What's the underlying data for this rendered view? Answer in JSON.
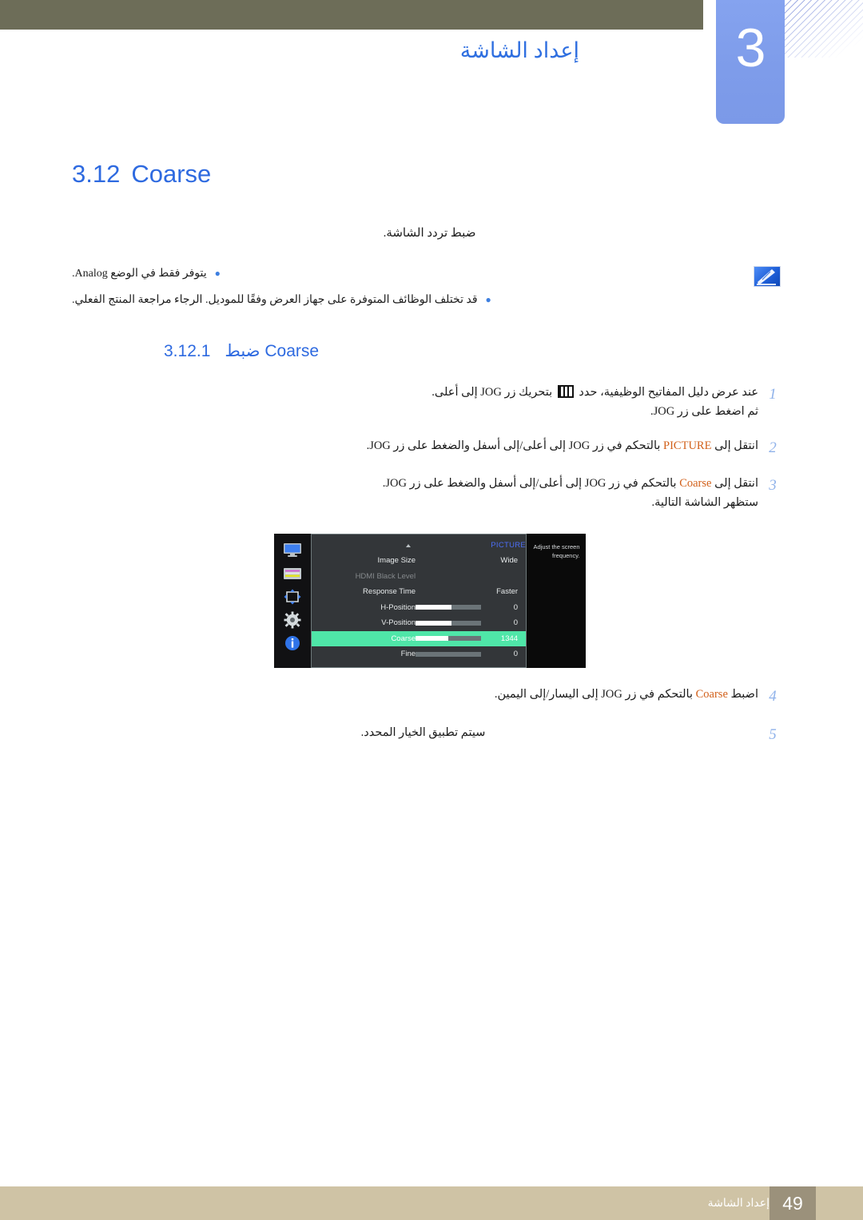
{
  "header": {
    "chapter_number": "3",
    "chapter_title": "إعداد الشاشة"
  },
  "section": {
    "number": "3.12",
    "title": "Coarse",
    "intro": "ضبط تردد الشاشة."
  },
  "note": {
    "icon_name": "note-pen-icon",
    "bullets": [
      "يتوفر فقط في الوضع Analog.",
      "قد تختلف الوظائف المتوفرة على جهاز العرض وفقًا للموديل. الرجاء مراجعة المنتج الفعلي."
    ]
  },
  "subsection": {
    "number": "3.12.1",
    "title_ar": "ضبط",
    "title_en": "Coarse"
  },
  "steps": [
    {
      "num": "1",
      "text_before": "عند عرض دليل المفاتيح الوظيفية، حدد",
      "icon": "function-key-guide-icon",
      "text_after": "بتحريك زر JOG إلى أعلى.",
      "sub": "ثم اضغط على زر JOG."
    },
    {
      "num": "2",
      "text_before": "انتقل إلى",
      "highlight": "PICTURE",
      "text_after": "بالتحكم في زر JOG إلى أعلى/إلى أسفل والضغط على زر JOG.",
      "sub": ""
    },
    {
      "num": "3",
      "text_before": "انتقل إلى",
      "highlight": "Coarse",
      "text_after": "بالتحكم في زر JOG إلى أعلى/إلى أسفل والضغط على زر JOG.",
      "sub": "ستظهر الشاشة التالية."
    },
    {
      "num": "4",
      "text_before": "اضبط",
      "highlight": "Coarse",
      "text_after": "بالتحكم في زر JOG إلى اليسار/إلى اليمين.",
      "sub": ""
    },
    {
      "num": "5",
      "text_before": "سيتم تطبيق الخيار المحدد.",
      "highlight": "",
      "text_after": "",
      "sub": ""
    }
  ],
  "osd": {
    "menu_title": "PICTURE",
    "rail_icons": [
      "monitor-icon",
      "osd-list-icon",
      "position-arrows-icon",
      "gear-icon",
      "info-icon"
    ],
    "help_text": "Adjust the screen frequency.",
    "rows": [
      {
        "label": "Image Size",
        "value": "Wide",
        "has_bar": false,
        "fill": 0,
        "state": "normal"
      },
      {
        "label": "HDMI Black Level",
        "value": "",
        "has_bar": false,
        "fill": 0,
        "state": "disabled"
      },
      {
        "label": "Response Time",
        "value": "Faster",
        "has_bar": false,
        "fill": 0,
        "state": "normal"
      },
      {
        "label": "H-Position",
        "value": "0",
        "has_bar": true,
        "fill": 55,
        "state": "normal"
      },
      {
        "label": "V-Position",
        "value": "0",
        "has_bar": true,
        "fill": 55,
        "state": "normal"
      },
      {
        "label": "Coarse",
        "value": "1344",
        "has_bar": true,
        "fill": 50,
        "state": "selected"
      },
      {
        "label": "Fine",
        "value": "0",
        "has_bar": true,
        "fill": 0,
        "state": "normal"
      }
    ],
    "colors": {
      "highlight": "#4fe6a8",
      "menu_title": "#4c6ef5",
      "panel_bg": "#333639"
    }
  },
  "footer": {
    "page_number": "49",
    "label": "إعداد الشاشة"
  }
}
